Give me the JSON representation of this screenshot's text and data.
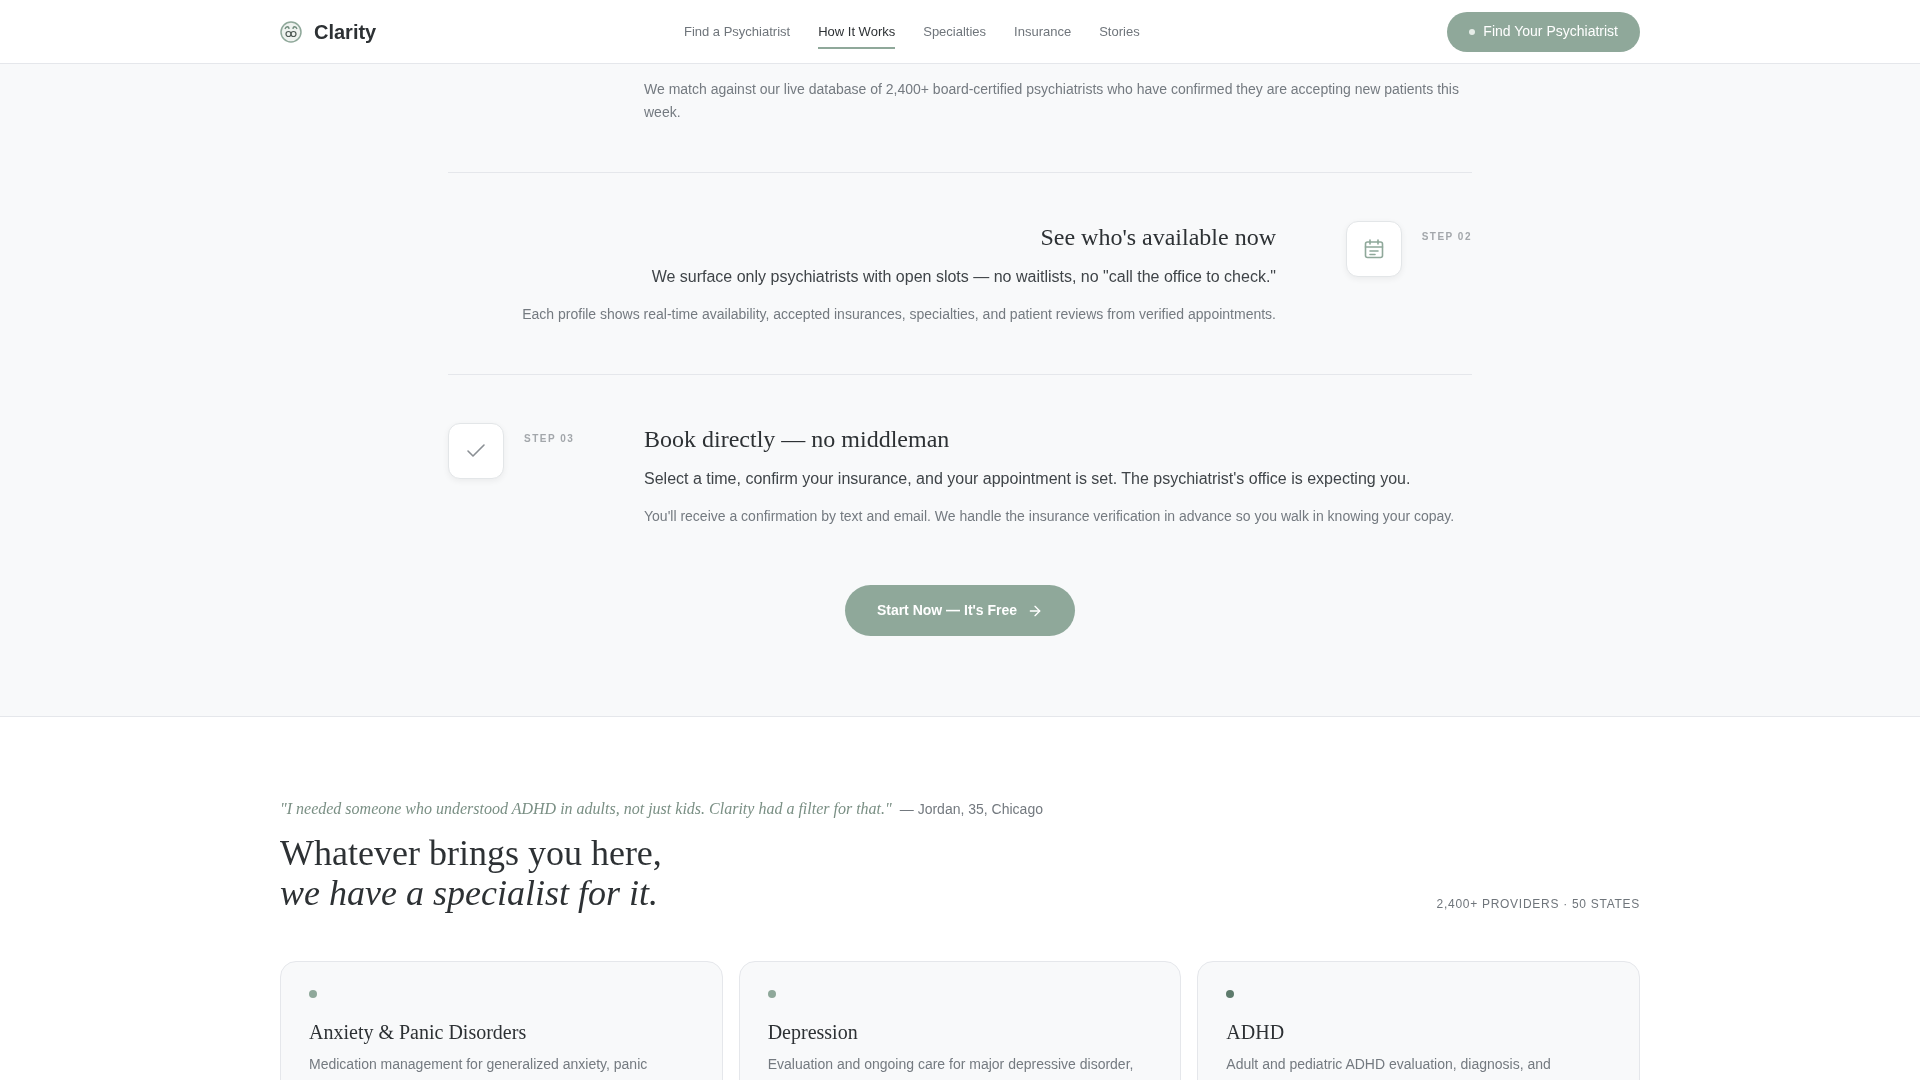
{
  "header": {
    "brand": "Clarity",
    "nav": [
      {
        "label": "Find a Psychiatrist",
        "selected": false
      },
      {
        "label": "How It Works",
        "selected": true
      },
      {
        "label": "Specialties",
        "selected": false
      },
      {
        "label": "Insurance",
        "selected": false
      },
      {
        "label": "Stories",
        "selected": false
      }
    ],
    "cta": "Find Your Psychiatrist"
  },
  "steps": [
    {
      "detail": "We match against our live database of 2,400+ board-certified psychiatrists who have confirmed they are accepting new patients this week."
    },
    {
      "label": "STEP 02",
      "title": "See who's available now",
      "lead": "We surface only psychiatrists with open slots — no waitlists, no \"call the office to check.\"",
      "detail": "Each profile shows real-time availability, accepted insurances, specialties, and patient reviews from verified appointments."
    },
    {
      "label": "STEP 03",
      "title": "Book directly — no middleman",
      "lead": "Select a time, confirm your insurance, and your appointment is set. The psychiatrist's office is expecting you.",
      "detail": "You'll receive a confirmation by text and email. We handle the insurance verification in advance so you walk in knowing your copay."
    }
  ],
  "start_button": "Start Now — It's Free",
  "specialties": {
    "quote": "\"I needed someone who understood ADHD in adults, not just kids. Clarity had a filter for that.\"",
    "attribution": "— Jordan, 35, Chicago",
    "heading": "Whatever brings you here, *we have a specialist for it.*",
    "stats": "2,400+ PROVIDERS · 50 STATES",
    "cards": [
      {
        "title": "Anxiety & Panic Disorders",
        "description": "Medication management for generalized anxiety, panic",
        "color": "#8fa89a"
      },
      {
        "title": "Depression",
        "description": "Evaluation and ongoing care for major depressive disorder,",
        "color": "#8fa89a"
      },
      {
        "title": "ADHD",
        "description": "Adult and pediatric ADHD evaluation, diagnosis, and",
        "color": "#5e7b6c"
      }
    ]
  }
}
